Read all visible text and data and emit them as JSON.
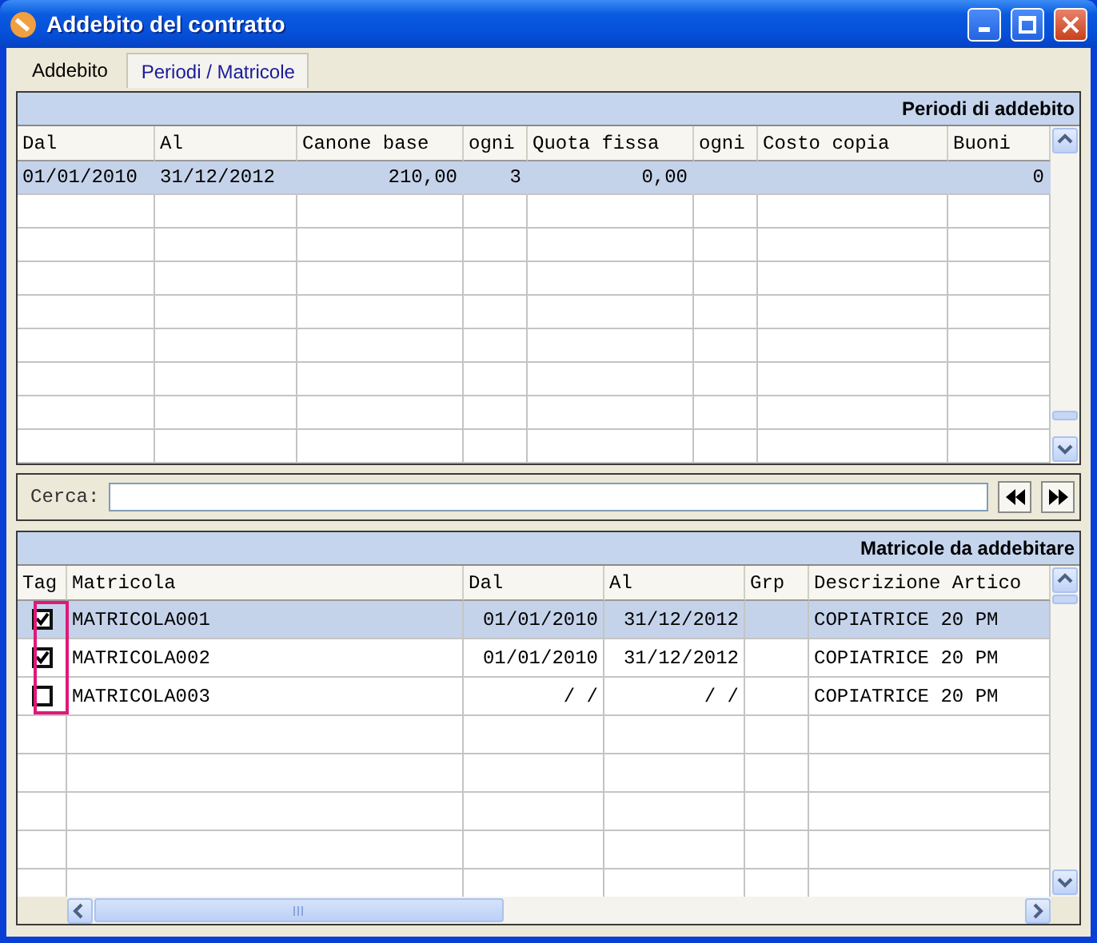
{
  "window": {
    "title": "Addebito del contratto"
  },
  "tabs": [
    {
      "label": "Addebito",
      "selected": false
    },
    {
      "label": "Periodi / Matricole",
      "selected": true
    }
  ],
  "periods": {
    "title": "Periodi di addebito",
    "columns": [
      "Dal",
      "Al",
      "Canone base",
      "ogni",
      "Quota fissa",
      "ogni",
      "Costo copia",
      "Buoni"
    ],
    "rows": [
      {
        "selected": true,
        "cells": [
          "01/01/2010",
          "31/12/2012",
          "210,00",
          "3",
          "0,00",
          null,
          null,
          "0"
        ]
      }
    ]
  },
  "search": {
    "label": "Cerca:"
  },
  "serials": {
    "title": "Matricole da addebitare",
    "columns": [
      "Tag",
      "Matricola",
      "Dal",
      "Al",
      "Grp",
      "Descrizione Artico"
    ],
    "rows": [
      {
        "selected": true,
        "checked": true,
        "cells": [
          null,
          "MATRICOLA001",
          "01/01/2010",
          "31/12/2012",
          null,
          "COPIATRICE 20 PM"
        ]
      },
      {
        "selected": false,
        "checked": true,
        "cells": [
          null,
          "MATRICOLA002",
          "01/01/2010",
          "31/12/2012",
          null,
          "COPIATRICE 20 PM"
        ]
      },
      {
        "selected": false,
        "checked": false,
        "cells": [
          null,
          "MATRICOLA003",
          "/  /",
          "/  /",
          null,
          "COPIATRICE 20 PM"
        ]
      }
    ]
  }
}
